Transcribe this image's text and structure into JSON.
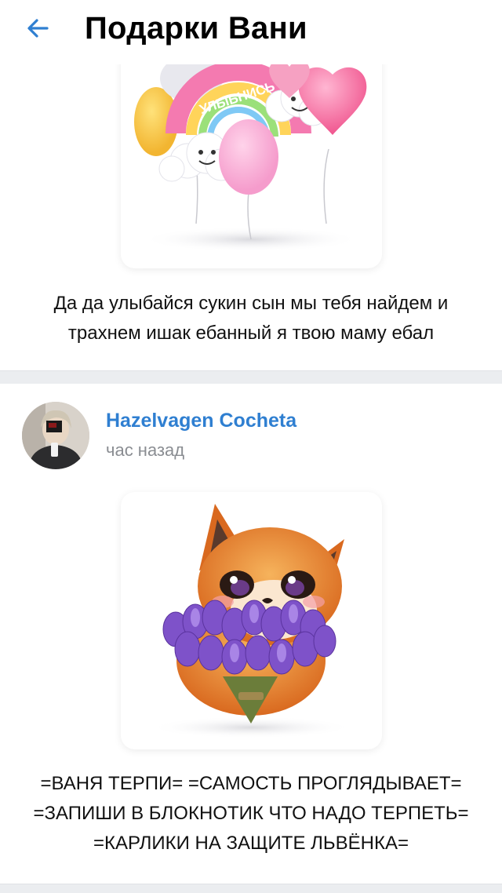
{
  "header": {
    "title": "Подарки Вани",
    "back_icon": "arrow-left-icon",
    "accent": "#2f7fd1"
  },
  "gifts": [
    {
      "image": "balloons-smile-rainbow-sticker",
      "sticker_text": "УЛЫБНИСЬ",
      "message": "Да да улыбайся сукин сын мы тебя найдем и трахнем ишак ебанный я твою маму ебал"
    },
    {
      "author": "Hazelvagen Cocheta",
      "time": "час назад",
      "avatar": "user-avatar-photo",
      "image": "fox-with-crocus-bouquet-sticker",
      "message": "=ВАНЯ ТЕРПИ= =САМОСТЬ ПРОГЛЯДЫВАЕТ= =ЗАПИШИ В БЛОКНОТИК ЧТО НАДО ТЕРПЕТЬ= =КАРЛИКИ НА ЗАЩИТЕ ЛЬВЁНКА="
    }
  ]
}
